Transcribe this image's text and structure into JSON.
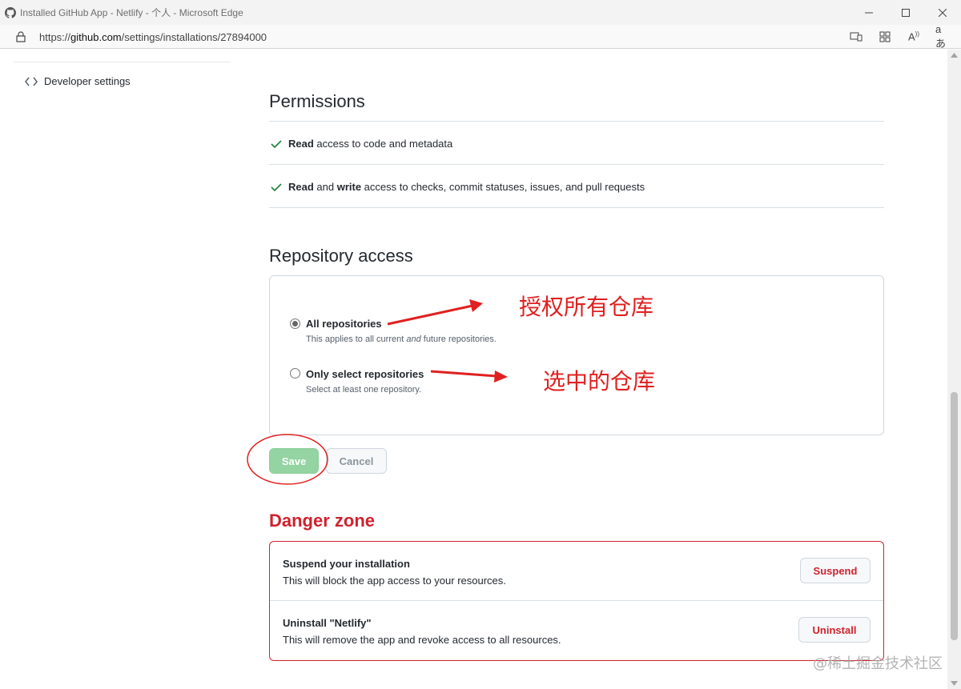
{
  "window": {
    "title": "Installed GitHub App - Netlify - 个人 - Microsoft Edge",
    "url_prefix": "https://",
    "url_host": "github.com",
    "url_path": "/settings/installations/27894000"
  },
  "sidebar": {
    "developer_settings": "Developer settings"
  },
  "permissions": {
    "heading": "Permissions",
    "items": [
      {
        "bold": "Read",
        "text": " access to code and metadata"
      },
      {
        "bold1": "Read",
        "mid": " and ",
        "bold2": "write",
        "text": " access to checks, commit statuses, issues, and pull requests"
      }
    ]
  },
  "repository_access": {
    "heading": "Repository access",
    "all_label": "All repositories",
    "all_note_pre": "This applies to all current ",
    "all_note_em": "and",
    "all_note_post": " future repositories.",
    "select_label": "Only select repositories",
    "select_note": "Select at least one repository.",
    "selected": "all"
  },
  "annotations": {
    "all": "授权所有仓库",
    "select": "选中的仓库",
    "color": "#e02020"
  },
  "buttons": {
    "save": "Save",
    "cancel": "Cancel"
  },
  "danger_zone": {
    "heading": "Danger zone",
    "suspend_title": "Suspend your installation",
    "suspend_desc": "This will block the app access to your resources.",
    "suspend_button": "Suspend",
    "uninstall_title": "Uninstall \"Netlify\"",
    "uninstall_desc": "This will remove the app and revoke access to all resources.",
    "uninstall_button": "Uninstall"
  },
  "watermark": "@稀土掘金技术社区",
  "colors": {
    "danger": "#cf222e",
    "success_check": "#1a7f37",
    "save_disabled": "#94d3a2"
  }
}
